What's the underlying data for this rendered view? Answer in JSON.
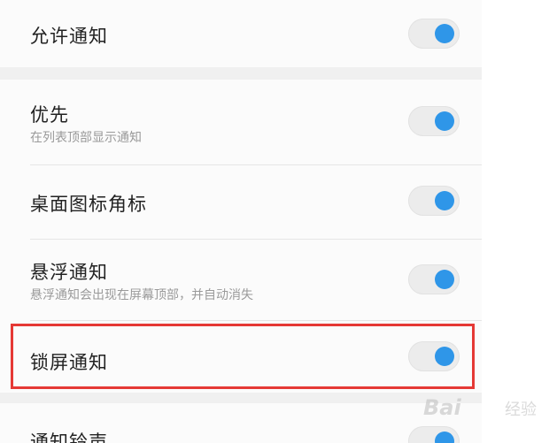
{
  "settings": {
    "allow_notifications": {
      "title": "允许通知",
      "enabled": true
    },
    "priority": {
      "title": "优先",
      "subtitle": "在列表顶部显示通知",
      "enabled": true
    },
    "desktop_badge": {
      "title": "桌面图标角标",
      "enabled": true
    },
    "floating_notifications": {
      "title": "悬浮通知",
      "subtitle": "悬浮通知会出现在屏幕顶部，并自动消失",
      "enabled": true
    },
    "lockscreen_notifications": {
      "title": "锁屏通知",
      "enabled": true,
      "highlighted": true
    },
    "notification_ringtone": {
      "title": "通知铃声",
      "enabled": true
    }
  },
  "colors": {
    "toggle_on": "#2f96e8",
    "highlight": "#e53935"
  },
  "watermark": {
    "brand": "Bai",
    "text": "经验"
  }
}
